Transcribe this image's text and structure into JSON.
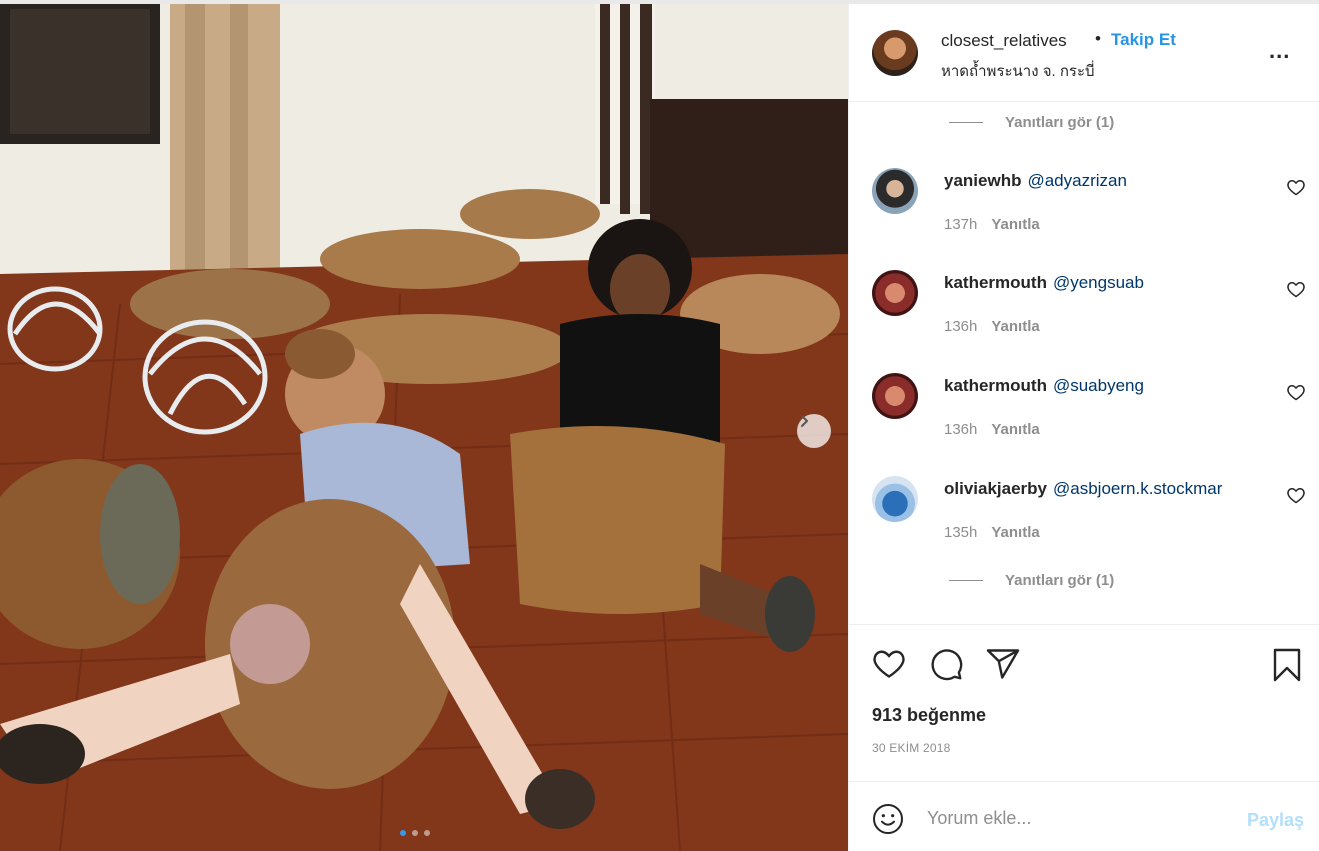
{
  "post": {
    "photo_description_icon": "photo",
    "carousel": {
      "total": 3,
      "active": 0
    }
  },
  "header": {
    "username": "closest_relatives",
    "separator": "•",
    "follow_label": "Takip Et",
    "location": "หาดถ้ำพระนาง จ. กระบี่",
    "more_label": "..."
  },
  "replies_top": {
    "label": "Yanıtları gör (1)"
  },
  "comments": [
    {
      "user": "yaniewhb",
      "mention": "@adyazrizan",
      "time": "137h",
      "reply": "Yanıtla"
    },
    {
      "user": "kathermouth",
      "mention": "@yengsuab",
      "time": "136h",
      "reply": "Yanıtla"
    },
    {
      "user": "kathermouth",
      "mention": "@suabyeng",
      "time": "136h",
      "reply": "Yanıtla"
    },
    {
      "user": "oliviakjaerby",
      "mention": "@asbjoern.k.stockmar",
      "time": "135h",
      "reply": "Yanıtla"
    }
  ],
  "replies_bottom": {
    "label": "Yanıtları gör (1)"
  },
  "actions": {
    "likes": "913 beğenme",
    "date": "30 EKİM 2018",
    "icons": [
      "heart-icon",
      "comment-icon",
      "share-icon",
      "bookmark-icon"
    ]
  },
  "add_comment": {
    "placeholder": "Yorum ekle...",
    "share_label": "Paylaş"
  },
  "colors": {
    "link_blue": "#2795e6",
    "share_disabled": "#b2dffc",
    "meta_gray": "#8e8e8e",
    "text": "#262626"
  }
}
